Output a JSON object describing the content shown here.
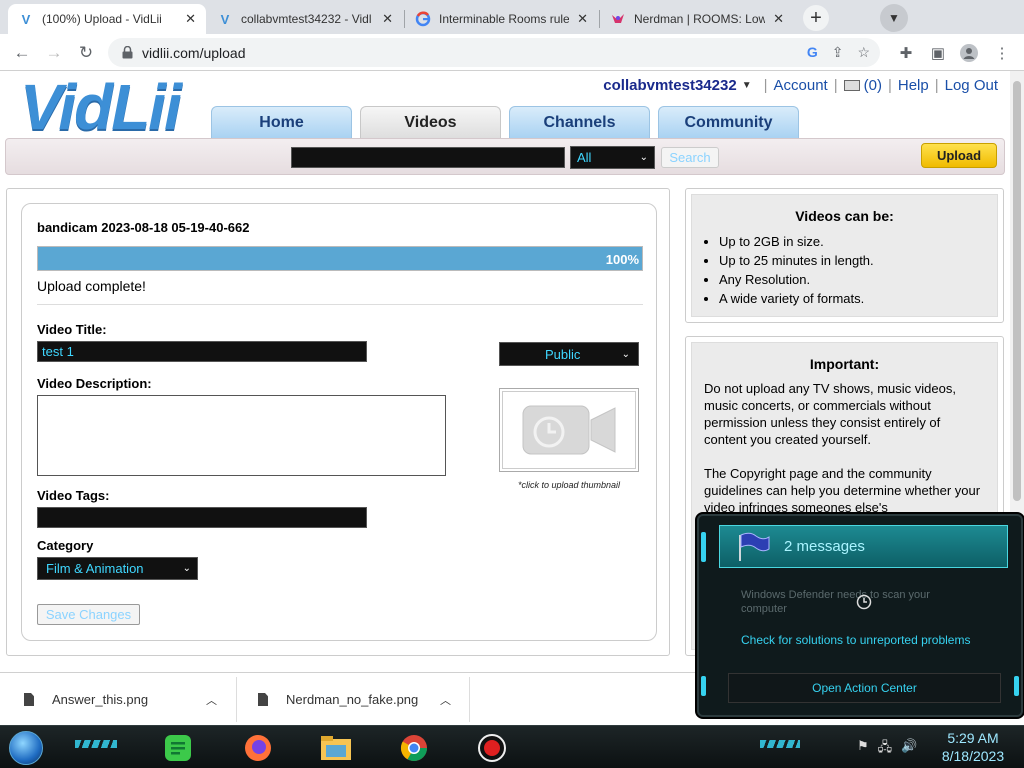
{
  "browser": {
    "tabs": [
      {
        "title": "(100%) Upload - VidLii",
        "favicon": "V",
        "active": true
      },
      {
        "title": "collabvmtest34232 - Vidl",
        "favicon": "V",
        "active": false
      },
      {
        "title": "Interminable Rooms rule",
        "favicon": "G",
        "active": false
      },
      {
        "title": "Nerdman | ROOMS: Low",
        "favicon": "bird-icon",
        "active": false
      }
    ],
    "new_tab_label": "+",
    "url": "vidlii.com/upload"
  },
  "site": {
    "logo_text": "VidLii",
    "username": "collabvmtest34232",
    "account_label": "Account",
    "inbox_count": "(0)",
    "help_label": "Help",
    "logout_label": "Log Out",
    "nav_tabs": [
      "Home",
      "Videos",
      "Channels",
      "Community"
    ],
    "active_nav": "Videos",
    "search": {
      "select_value": "All",
      "button_label": "Search"
    },
    "upload_button": "Upload"
  },
  "upload": {
    "file_name": "bandicam 2023-08-18 05-19-40-662",
    "progress_percent": 100,
    "progress_label": "100%",
    "status": "Upload complete!",
    "title_label": "Video Title:",
    "title_value": "test 1",
    "description_label": "Video Description:",
    "description_value": "",
    "tags_label": "Video Tags:",
    "tags_value": "",
    "category_label": "Category",
    "category_value": "Film & Animation",
    "privacy_value": "Public",
    "thumbnail_caption": "*click to upload thumbnail",
    "save_button": "Save Changes"
  },
  "sidebar": {
    "videos_can_be": {
      "title": "Videos can be:",
      "items": [
        "Up to 2GB in size.",
        "Up to 25 minutes in length.",
        "Any Resolution.",
        "A wide variety of formats."
      ]
    },
    "important": {
      "title": "Important:",
      "paragraph1": "Do not upload any TV shows, music videos, music concerts, or commercials without permission unless they consist entirely of content you created yourself.",
      "paragraph2": "The Copyright page and the community guidelines can help you determine whether your video infringes someones else's"
    }
  },
  "downloads": [
    {
      "file": "Answer_this.png"
    },
    {
      "file": "Nerdman_no_fake.png"
    }
  ],
  "action_center": {
    "header": "2 messages",
    "message1": "Windows Defender needs to scan your computer",
    "message2": "Check for solutions to unreported problems",
    "button": "Open Action Center"
  },
  "taskbar": {
    "time": "5:29 AM",
    "date": "8/18/2023"
  },
  "colors": {
    "accent_cyan": "#36d2f0",
    "progress_fill": "#5aa7d3",
    "upload_yellow": "#f0bb00",
    "username_blue": "#1a2a8c"
  }
}
